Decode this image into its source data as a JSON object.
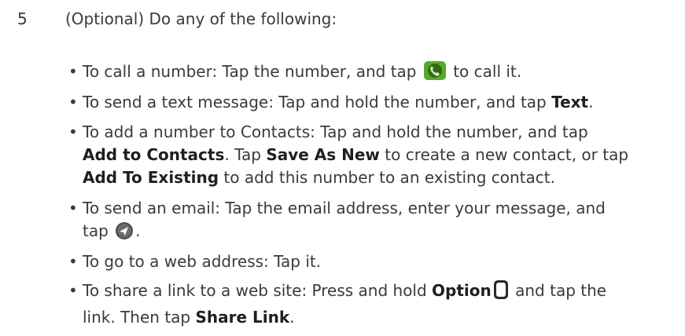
{
  "step": {
    "number": "5",
    "intro": "(Optional) Do any of the following:"
  },
  "items": [
    {
      "a": "To call a number: Tap the number, and tap ",
      "icon": "phone-call-icon",
      "b": " to call it."
    },
    {
      "a": "To send a text message: Tap and hold the number, and tap ",
      "b1": "Text",
      "c": "."
    },
    {
      "a": "To add a number to Contacts: Tap and hold the number, and tap",
      "b1": "Add to Contacts",
      "c": ". Tap ",
      "b2": "Save As New",
      "d": " to create a new contact, or tap",
      "b3": "Add To Existing",
      "e": " to add this number to an existing contact."
    },
    {
      "a": "To send an email: Tap the email address, enter your message, and",
      "b": "tap ",
      "icon": "send-icon",
      "c": "."
    },
    {
      "a": "To go to a web address: Tap it."
    },
    {
      "a": "To share a link to a web site: Press and hold ",
      "b1": "Option",
      "icon": "option-key-icon",
      "c": " and tap the",
      "d": "link. Then tap ",
      "b2": "Share Link",
      "e": "."
    }
  ],
  "bullet": "•",
  "colors": {
    "text": "#3a3a3a",
    "bold": "#1f1f1f",
    "phone_icon": "#5aa82a",
    "send_icon": "#4a4a4a"
  }
}
